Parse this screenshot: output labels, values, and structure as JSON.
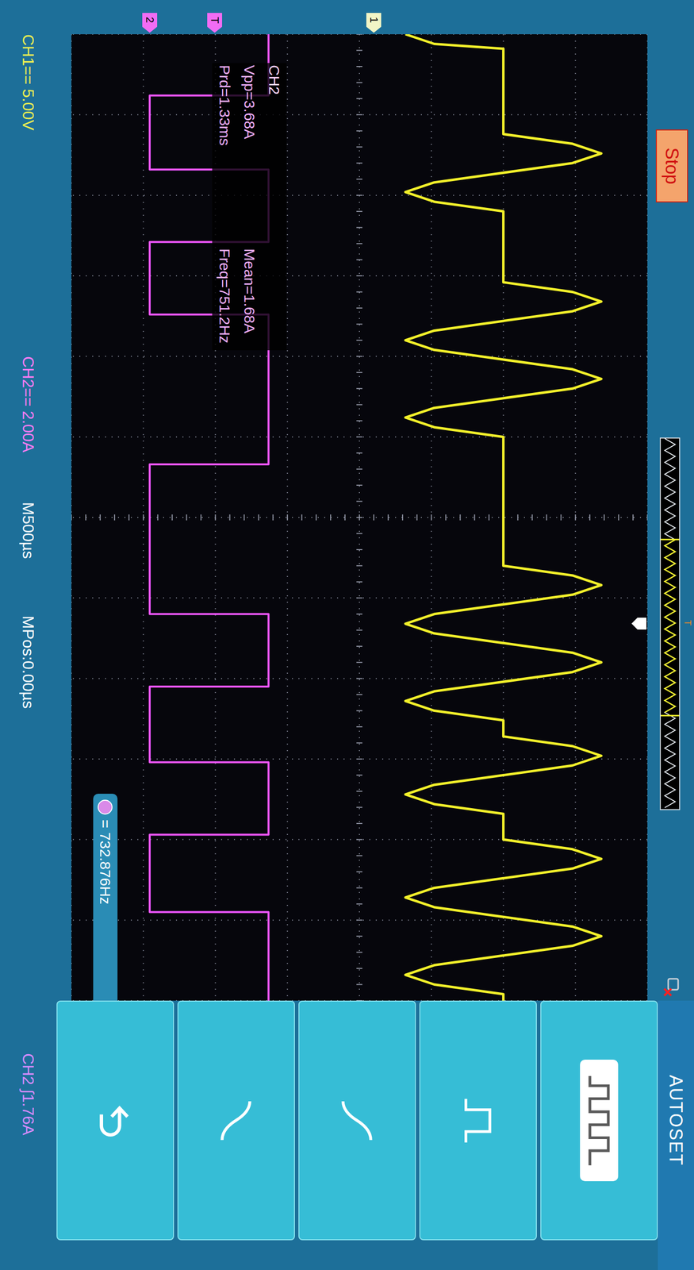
{
  "status": {
    "run_state": "Stop"
  },
  "markers": [
    {
      "label": "2",
      "color": "#f26cf4"
    },
    {
      "label": "T",
      "color": "#f26cf4"
    },
    {
      "label": "1",
      "color": "#f2f5c6"
    }
  ],
  "timebase": {
    "trigger_label": "T",
    "window_start": 0.27,
    "window_end": 0.75
  },
  "measurements": {
    "channel": "CH2",
    "items": [
      "Vpp=3.68A",
      "Mean=1.68A",
      "Prd=1.33ms",
      "Freq=751.2Hz"
    ]
  },
  "counter": {
    "reading": "= 732.876Hz"
  },
  "chart": {
    "series": [
      {
        "name": "CH1",
        "unit": "V",
        "color": "#f2f02a",
        "points": [
          [
            0,
            2.2
          ],
          [
            0.06,
            4.2
          ],
          [
            0.09,
            9.0
          ],
          [
            0.62,
            9.0
          ],
          [
            0.68,
            13.8
          ],
          [
            0.74,
            15.8
          ],
          [
            0.8,
            13.8
          ],
          [
            0.86,
            9.0
          ],
          [
            0.92,
            4.2
          ],
          [
            0.98,
            2.2
          ],
          [
            1.04,
            4.2
          ],
          [
            1.1,
            9.0
          ],
          [
            1.54,
            9.0
          ],
          [
            1.6,
            13.8
          ],
          [
            1.66,
            15.8
          ],
          [
            1.72,
            13.8
          ],
          [
            1.78,
            9.0
          ],
          [
            1.84,
            4.2
          ],
          [
            1.9,
            2.2
          ],
          [
            1.96,
            4.2
          ],
          [
            2.02,
            9.0
          ],
          [
            2.08,
            13.8
          ],
          [
            2.14,
            15.8
          ],
          [
            2.2,
            13.8
          ],
          [
            2.26,
            9.0
          ],
          [
            2.32,
            4.2
          ],
          [
            2.38,
            2.2
          ],
          [
            2.44,
            4.2
          ],
          [
            2.5,
            9.0
          ],
          [
            3.3,
            9.0
          ],
          [
            3.36,
            13.8
          ],
          [
            3.42,
            15.8
          ],
          [
            3.48,
            13.8
          ],
          [
            3.54,
            9.0
          ],
          [
            3.6,
            4.2
          ],
          [
            3.66,
            2.2
          ],
          [
            3.72,
            4.2
          ],
          [
            3.78,
            9.0
          ],
          [
            3.84,
            13.8
          ],
          [
            3.9,
            15.8
          ],
          [
            3.96,
            13.8
          ],
          [
            4.02,
            9.0
          ],
          [
            4.08,
            4.2
          ],
          [
            4.14,
            2.2
          ],
          [
            4.2,
            4.2
          ],
          [
            4.26,
            9.0
          ],
          [
            4.36,
            9.0
          ],
          [
            4.42,
            13.8
          ],
          [
            4.48,
            15.8
          ],
          [
            4.54,
            13.8
          ],
          [
            4.6,
            9.0
          ],
          [
            4.66,
            4.2
          ],
          [
            4.72,
            2.2
          ],
          [
            4.78,
            4.2
          ],
          [
            4.84,
            9.0
          ],
          [
            5.0,
            9.0
          ],
          [
            5.06,
            13.8
          ],
          [
            5.12,
            15.8
          ],
          [
            5.18,
            13.8
          ],
          [
            5.24,
            9.0
          ],
          [
            5.3,
            4.2
          ],
          [
            5.36,
            2.2
          ],
          [
            5.42,
            4.2
          ],
          [
            5.48,
            9.0
          ],
          [
            5.54,
            13.8
          ],
          [
            5.6,
            15.8
          ],
          [
            5.66,
            13.8
          ],
          [
            5.72,
            9.0
          ],
          [
            5.78,
            4.2
          ],
          [
            5.84,
            2.2
          ],
          [
            5.9,
            4.2
          ],
          [
            5.96,
            9.0
          ],
          [
            6.0,
            9.0
          ]
        ]
      },
      {
        "name": "CH2",
        "unit": "A",
        "color": "#ee55ff",
        "points": [
          [
            0,
            3.3
          ],
          [
            0.38,
            3.3
          ],
          [
            0.38,
            0
          ],
          [
            0.84,
            0
          ],
          [
            0.84,
            3.3
          ],
          [
            1.29,
            3.3
          ],
          [
            1.29,
            0
          ],
          [
            1.74,
            0
          ],
          [
            1.74,
            3.3
          ],
          [
            2.67,
            3.3
          ],
          [
            2.67,
            0
          ],
          [
            3.6,
            0
          ],
          [
            3.6,
            3.3
          ],
          [
            4.05,
            3.3
          ],
          [
            4.05,
            0
          ],
          [
            4.52,
            0
          ],
          [
            4.52,
            3.3
          ],
          [
            4.97,
            3.3
          ],
          [
            4.97,
            0
          ],
          [
            5.45,
            0
          ],
          [
            5.45,
            3.3
          ],
          [
            6.0,
            3.3
          ]
        ]
      }
    ]
  },
  "status_bar": [
    {
      "text": "CH1== 5.00V",
      "color": "#f0f050"
    },
    {
      "text": "CH2== 2.00A",
      "color": "#ff7cf5"
    },
    {
      "text": "M500µs",
      "color": "#ffffff"
    },
    {
      "text": "MPos:0.00µs",
      "color": "#ffffff"
    },
    {
      "text": "CH2 ∫1.76A",
      "color": "#d98cff"
    }
  ],
  "menu": {
    "header": "AUTOSET",
    "buttons": [
      {
        "kind": "pulse-train",
        "selected": true
      },
      {
        "kind": "single-pulse",
        "selected": false
      },
      {
        "kind": "rising-edge",
        "selected": false
      },
      {
        "kind": "falling-edge",
        "selected": false
      },
      {
        "kind": "return",
        "selected": false
      }
    ]
  }
}
